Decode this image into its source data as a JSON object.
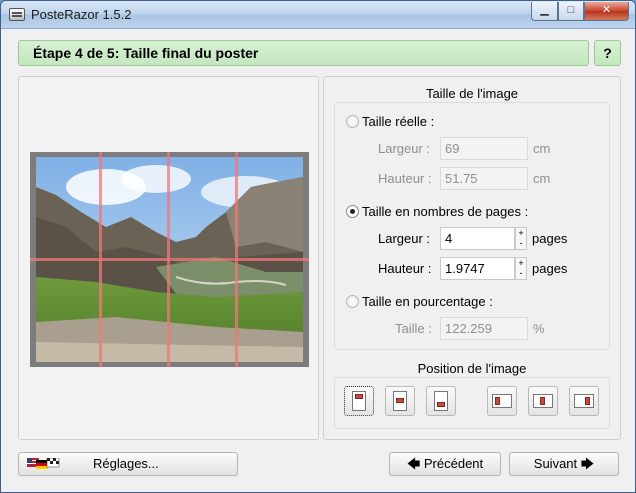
{
  "window": {
    "title": "PosteRazor 1.5.2",
    "controls": {
      "minimize": "▁",
      "maximize": "□",
      "close": "✕"
    }
  },
  "header": {
    "step_title": "Étape 4 de 5: Taille final du poster",
    "help_label": "?"
  },
  "image_size": {
    "group_title": "Taille de l'image",
    "real_size": {
      "label": "Taille réelle :",
      "selected": false,
      "width_label": "Largeur :",
      "width_value": "69",
      "width_unit": "cm",
      "height_label": "Hauteur :",
      "height_value": "51.75",
      "height_unit": "cm"
    },
    "pages": {
      "label": "Taille en nombres de pages :",
      "selected": true,
      "width_label": "Largeur :",
      "width_value": "4",
      "width_unit": "pages",
      "height_label": "Hauteur :",
      "height_value": "1.9747",
      "height_unit": "pages"
    },
    "percent": {
      "label": "Taille en pourcentage :",
      "selected": false,
      "size_label": "Taille :",
      "size_value": "122.259",
      "size_unit": "%"
    }
  },
  "image_position": {
    "group_title": "Position de l'image",
    "buttons": [
      "top-center",
      "center",
      "bottom-center",
      "left",
      "middle",
      "right"
    ],
    "selected": "top-center"
  },
  "preview": {
    "grid_columns": 4,
    "grid_rows": 2,
    "colors": {
      "frame": "#7c7c7c",
      "grid": "#f07878"
    }
  },
  "footer": {
    "settings_label": "Réglages...",
    "previous_label": "Précédent",
    "next_label": "Suivant",
    "previous_arrow": "🡄",
    "next_arrow": "🡆"
  }
}
